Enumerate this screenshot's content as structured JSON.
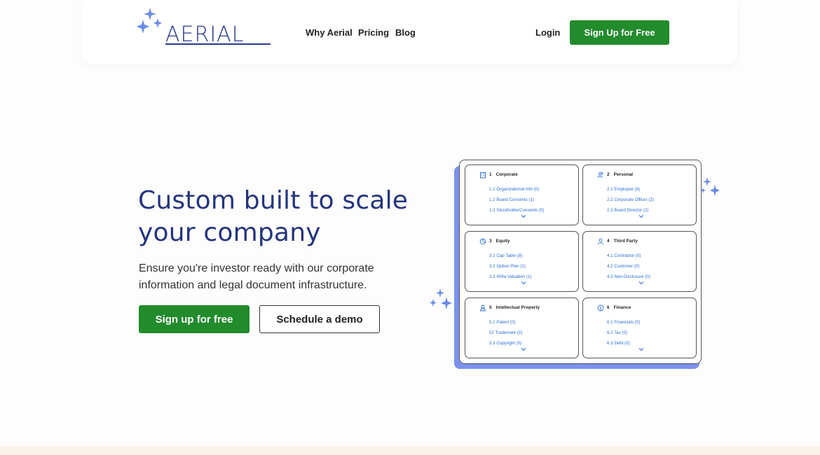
{
  "brand": {
    "name": "AERIAL"
  },
  "nav": {
    "links": [
      "Why Aerial",
      "Pricing",
      "Blog"
    ],
    "login": "Login",
    "signup": "Sign Up for Free"
  },
  "hero": {
    "title_line1": "Custom built to scale",
    "title_line2": "your company",
    "subtitle_line1": "Ensure you're investor ready with our corporate",
    "subtitle_line2": "information and legal document infrastructure.",
    "primary_cta": "Sign up for free",
    "secondary_cta": "Schedule a demo"
  },
  "colors": {
    "accent_green": "#228b2c",
    "brand_navy": "#24347e",
    "link_blue": "#2a6fd6",
    "card_shadow": "#7a92ee",
    "sparkle": "#6b8de8"
  },
  "grid": {
    "cells": [
      {
        "num": "1",
        "title": "Corporate",
        "icon": "building-icon",
        "items": [
          "1.1  Organizational Info (0)",
          "1.2  Board Consents (1)",
          "1.3  StockholderConsents (0)"
        ]
      },
      {
        "num": "2",
        "title": "Personal",
        "icon": "people-icon",
        "items": [
          "2.1 Employee (6)",
          "2.2  Corporate Officer (2)",
          "2.3  Board Director (2)"
        ]
      },
      {
        "num": "3",
        "title": "Equity",
        "icon": "pie-chart-icon",
        "items": [
          "3.1  Cap Table (8)",
          "3.2  Option Plan (1)",
          "3.3  409a Valuation (1)"
        ]
      },
      {
        "num": "4",
        "title": "Third Party",
        "icon": "person-icon",
        "items": [
          "4.1  Contractor (0)",
          "4.2  Customer (0)",
          "4.3  Non-Disclosure (0)"
        ]
      },
      {
        "num": "5",
        "title": "Intellectual Property",
        "icon": "stamp-icon",
        "items": [
          "5.1  Patent (0)",
          "52  Trademark (0)",
          "5.3  Copyright (0)"
        ]
      },
      {
        "num": "6",
        "title": "Finance",
        "icon": "dollar-coin-icon",
        "items": [
          "6.1  Financials (0)",
          "6.2  Tax (0)",
          "6.3  Debt (0)"
        ]
      }
    ]
  }
}
